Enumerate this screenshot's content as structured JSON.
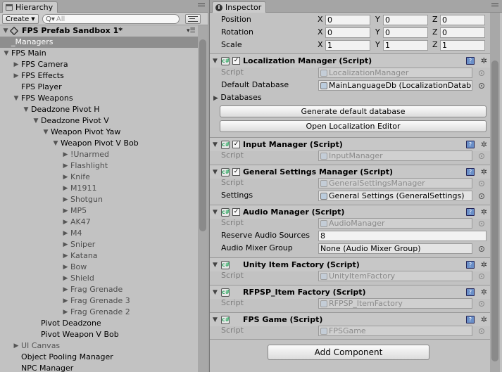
{
  "hierarchy": {
    "tab_label": "Hierarchy",
    "create_label": "Create",
    "search_prefix": "Q▾",
    "search_placeholder": "All",
    "scene_name": "FPS Prefab Sandbox 1*",
    "items": [
      {
        "label": "_Managers",
        "depth": 1,
        "arrow": "",
        "selected": true
      },
      {
        "label": "FPS Main",
        "depth": 1,
        "arrow": "open"
      },
      {
        "label": "FPS Camera",
        "depth": 2,
        "arrow": "closed"
      },
      {
        "label": "FPS Effects",
        "depth": 2,
        "arrow": "closed"
      },
      {
        "label": "FPS Player",
        "depth": 2,
        "arrow": ""
      },
      {
        "label": "FPS Weapons",
        "depth": 2,
        "arrow": "open"
      },
      {
        "label": "Deadzone Pivot H",
        "depth": 3,
        "arrow": "open"
      },
      {
        "label": "Deadzone Pivot V",
        "depth": 4,
        "arrow": "open"
      },
      {
        "label": "Weapon Pivot Yaw",
        "depth": 5,
        "arrow": "open"
      },
      {
        "label": "Weapon Pivot V Bob",
        "depth": 6,
        "arrow": "open"
      },
      {
        "label": "!Unarmed",
        "depth": 7,
        "arrow": "closed",
        "gray": true
      },
      {
        "label": "Flashlight",
        "depth": 7,
        "arrow": "closed",
        "gray": true
      },
      {
        "label": "Knife",
        "depth": 7,
        "arrow": "closed",
        "gray": true
      },
      {
        "label": "M1911",
        "depth": 7,
        "arrow": "closed",
        "gray": true
      },
      {
        "label": "Shotgun",
        "depth": 7,
        "arrow": "closed",
        "gray": true
      },
      {
        "label": "MP5",
        "depth": 7,
        "arrow": "closed",
        "gray": true
      },
      {
        "label": "AK47",
        "depth": 7,
        "arrow": "closed",
        "gray": true
      },
      {
        "label": "M4",
        "depth": 7,
        "arrow": "closed",
        "gray": true
      },
      {
        "label": "Sniper",
        "depth": 7,
        "arrow": "closed",
        "gray": true
      },
      {
        "label": "Katana",
        "depth": 7,
        "arrow": "closed",
        "gray": true
      },
      {
        "label": "Bow",
        "depth": 7,
        "arrow": "closed",
        "gray": true
      },
      {
        "label": "Shield",
        "depth": 7,
        "arrow": "closed",
        "gray": true
      },
      {
        "label": "Frag Grenade",
        "depth": 7,
        "arrow": "closed",
        "gray": true
      },
      {
        "label": "Frag Grenade 3",
        "depth": 7,
        "arrow": "closed",
        "gray": true
      },
      {
        "label": "Frag Grenade 2",
        "depth": 7,
        "arrow": "closed",
        "gray": true
      },
      {
        "label": "Pivot Deadzone",
        "depth": 4,
        "arrow": ""
      },
      {
        "label": "Pivot Weapon V Bob",
        "depth": 4,
        "arrow": ""
      },
      {
        "label": "UI Canvas",
        "depth": 2,
        "arrow": "closed",
        "dim": true
      },
      {
        "label": "Object Pooling Manager",
        "depth": 2,
        "arrow": ""
      },
      {
        "label": "NPC Manager",
        "depth": 2,
        "arrow": ""
      }
    ]
  },
  "inspector": {
    "tab_label": "Inspector",
    "transform": [
      {
        "label": "Position",
        "x": "0",
        "y": "0",
        "z": "0"
      },
      {
        "label": "Rotation",
        "x": "0",
        "y": "0",
        "z": "0"
      },
      {
        "label": "Scale",
        "x": "1",
        "y": "1",
        "z": "1"
      }
    ],
    "axis_labels": {
      "x": "X",
      "y": "Y",
      "z": "Z"
    },
    "script_label": "Script",
    "localization": {
      "title": "Localization Manager (Script)",
      "script": "LocalizationManager",
      "default_db_label": "Default Database",
      "default_db_value": "MainLanguageDb (LocalizationDatab",
      "databases_label": "Databases",
      "generate_button": "Generate default database",
      "open_editor_button": "Open Localization Editor"
    },
    "input": {
      "title": "Input Manager (Script)",
      "script": "InputManager"
    },
    "general": {
      "title": "General Settings Manager (Script)",
      "script": "GeneralSettingsManager",
      "settings_label": "Settings",
      "settings_value": "General Settings (GeneralSettings)"
    },
    "audio": {
      "title": "Audio Manager (Script)",
      "script": "AudioManager",
      "reserve_label": "Reserve Audio Sources",
      "reserve_value": "8",
      "mixer_label": "Audio Mixer Group",
      "mixer_value": "None (Audio Mixer Group)"
    },
    "unity_item": {
      "title": "Unity Item Factory (Script)",
      "script": "UnityItemFactory"
    },
    "rfpsp_item": {
      "title": "RFPSP_Item Factory (Script)",
      "script": "RFPSP_ItemFactory"
    },
    "fps_game": {
      "title": "FPS Game (Script)",
      "script": "FPSGame"
    },
    "add_component": "Add Component"
  }
}
